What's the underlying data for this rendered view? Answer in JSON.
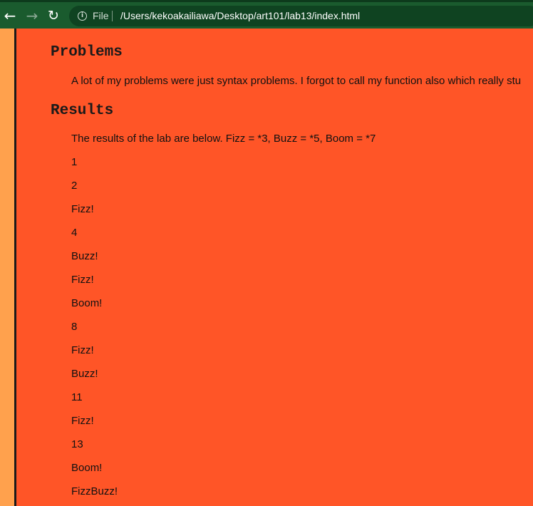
{
  "browser": {
    "scheme_label": "File",
    "url": "/Users/kekoakailiawa/Desktop/art101/lab13/index.html",
    "back_glyph": "←",
    "forward_glyph": "→",
    "reload_glyph": "↻",
    "info_glyph": "i",
    "toolbar_color": "#1a5b2e"
  },
  "page": {
    "background": "#ff5527",
    "outer_background": "#ffa14d",
    "sections": {
      "problems": {
        "heading": "Problems",
        "text": "A lot of my problems were just syntax problems. I forgot to call my function also which really stu"
      },
      "results": {
        "heading": "Results",
        "text": "The results of the lab are below. Fizz = *3, Buzz = *5, Boom = *7",
        "items": [
          "1",
          "2",
          "Fizz!",
          "4",
          "Buzz!",
          "Fizz!",
          "Boom!",
          "8",
          "Fizz!",
          "Buzz!",
          "11",
          "Fizz!",
          "13",
          "Boom!",
          "FizzBuzz!"
        ]
      }
    }
  }
}
